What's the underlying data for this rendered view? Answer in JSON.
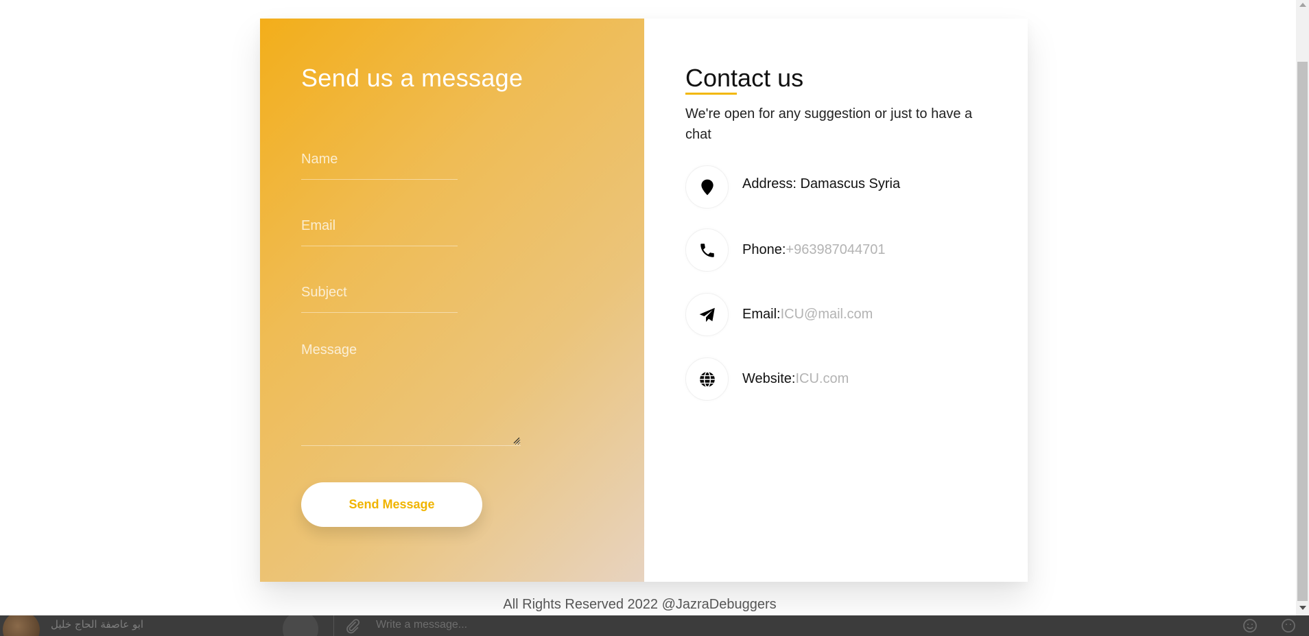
{
  "form": {
    "title": "Send us a message",
    "name_placeholder": "Name",
    "email_placeholder": "Email",
    "subject_placeholder": "Subject",
    "message_placeholder": "Message",
    "submit_label": "Send Message"
  },
  "contact": {
    "title": "Contact us",
    "intro": "We're open for any suggestion or just to have a chat",
    "address_label": "Address:",
    "address_value": " Damascus Syria",
    "phone_label": "Phone:",
    "phone_value": "+963987044701",
    "email_label": "Email:",
    "email_value": "ICU@mail.com",
    "website_label": "Website:",
    "website_value": "ICU.com"
  },
  "footer": {
    "text": "All Rights Reserved 2022 @JazraDebuggers"
  },
  "chatbar": {
    "contact_name": "ابو عاصفة الحاج خليل",
    "input_placeholder": "Write a message..."
  },
  "icons": {
    "address": "map-marker-icon",
    "phone": "phone-icon",
    "email": "paper-plane-icon",
    "website": "globe-icon"
  },
  "colors": {
    "accent": "#f2b705",
    "gradient_start": "#f3ae1a",
    "gradient_end": "#e7d3c0",
    "button_text": "#f0b400",
    "muted_text": "#b3b3b3"
  }
}
